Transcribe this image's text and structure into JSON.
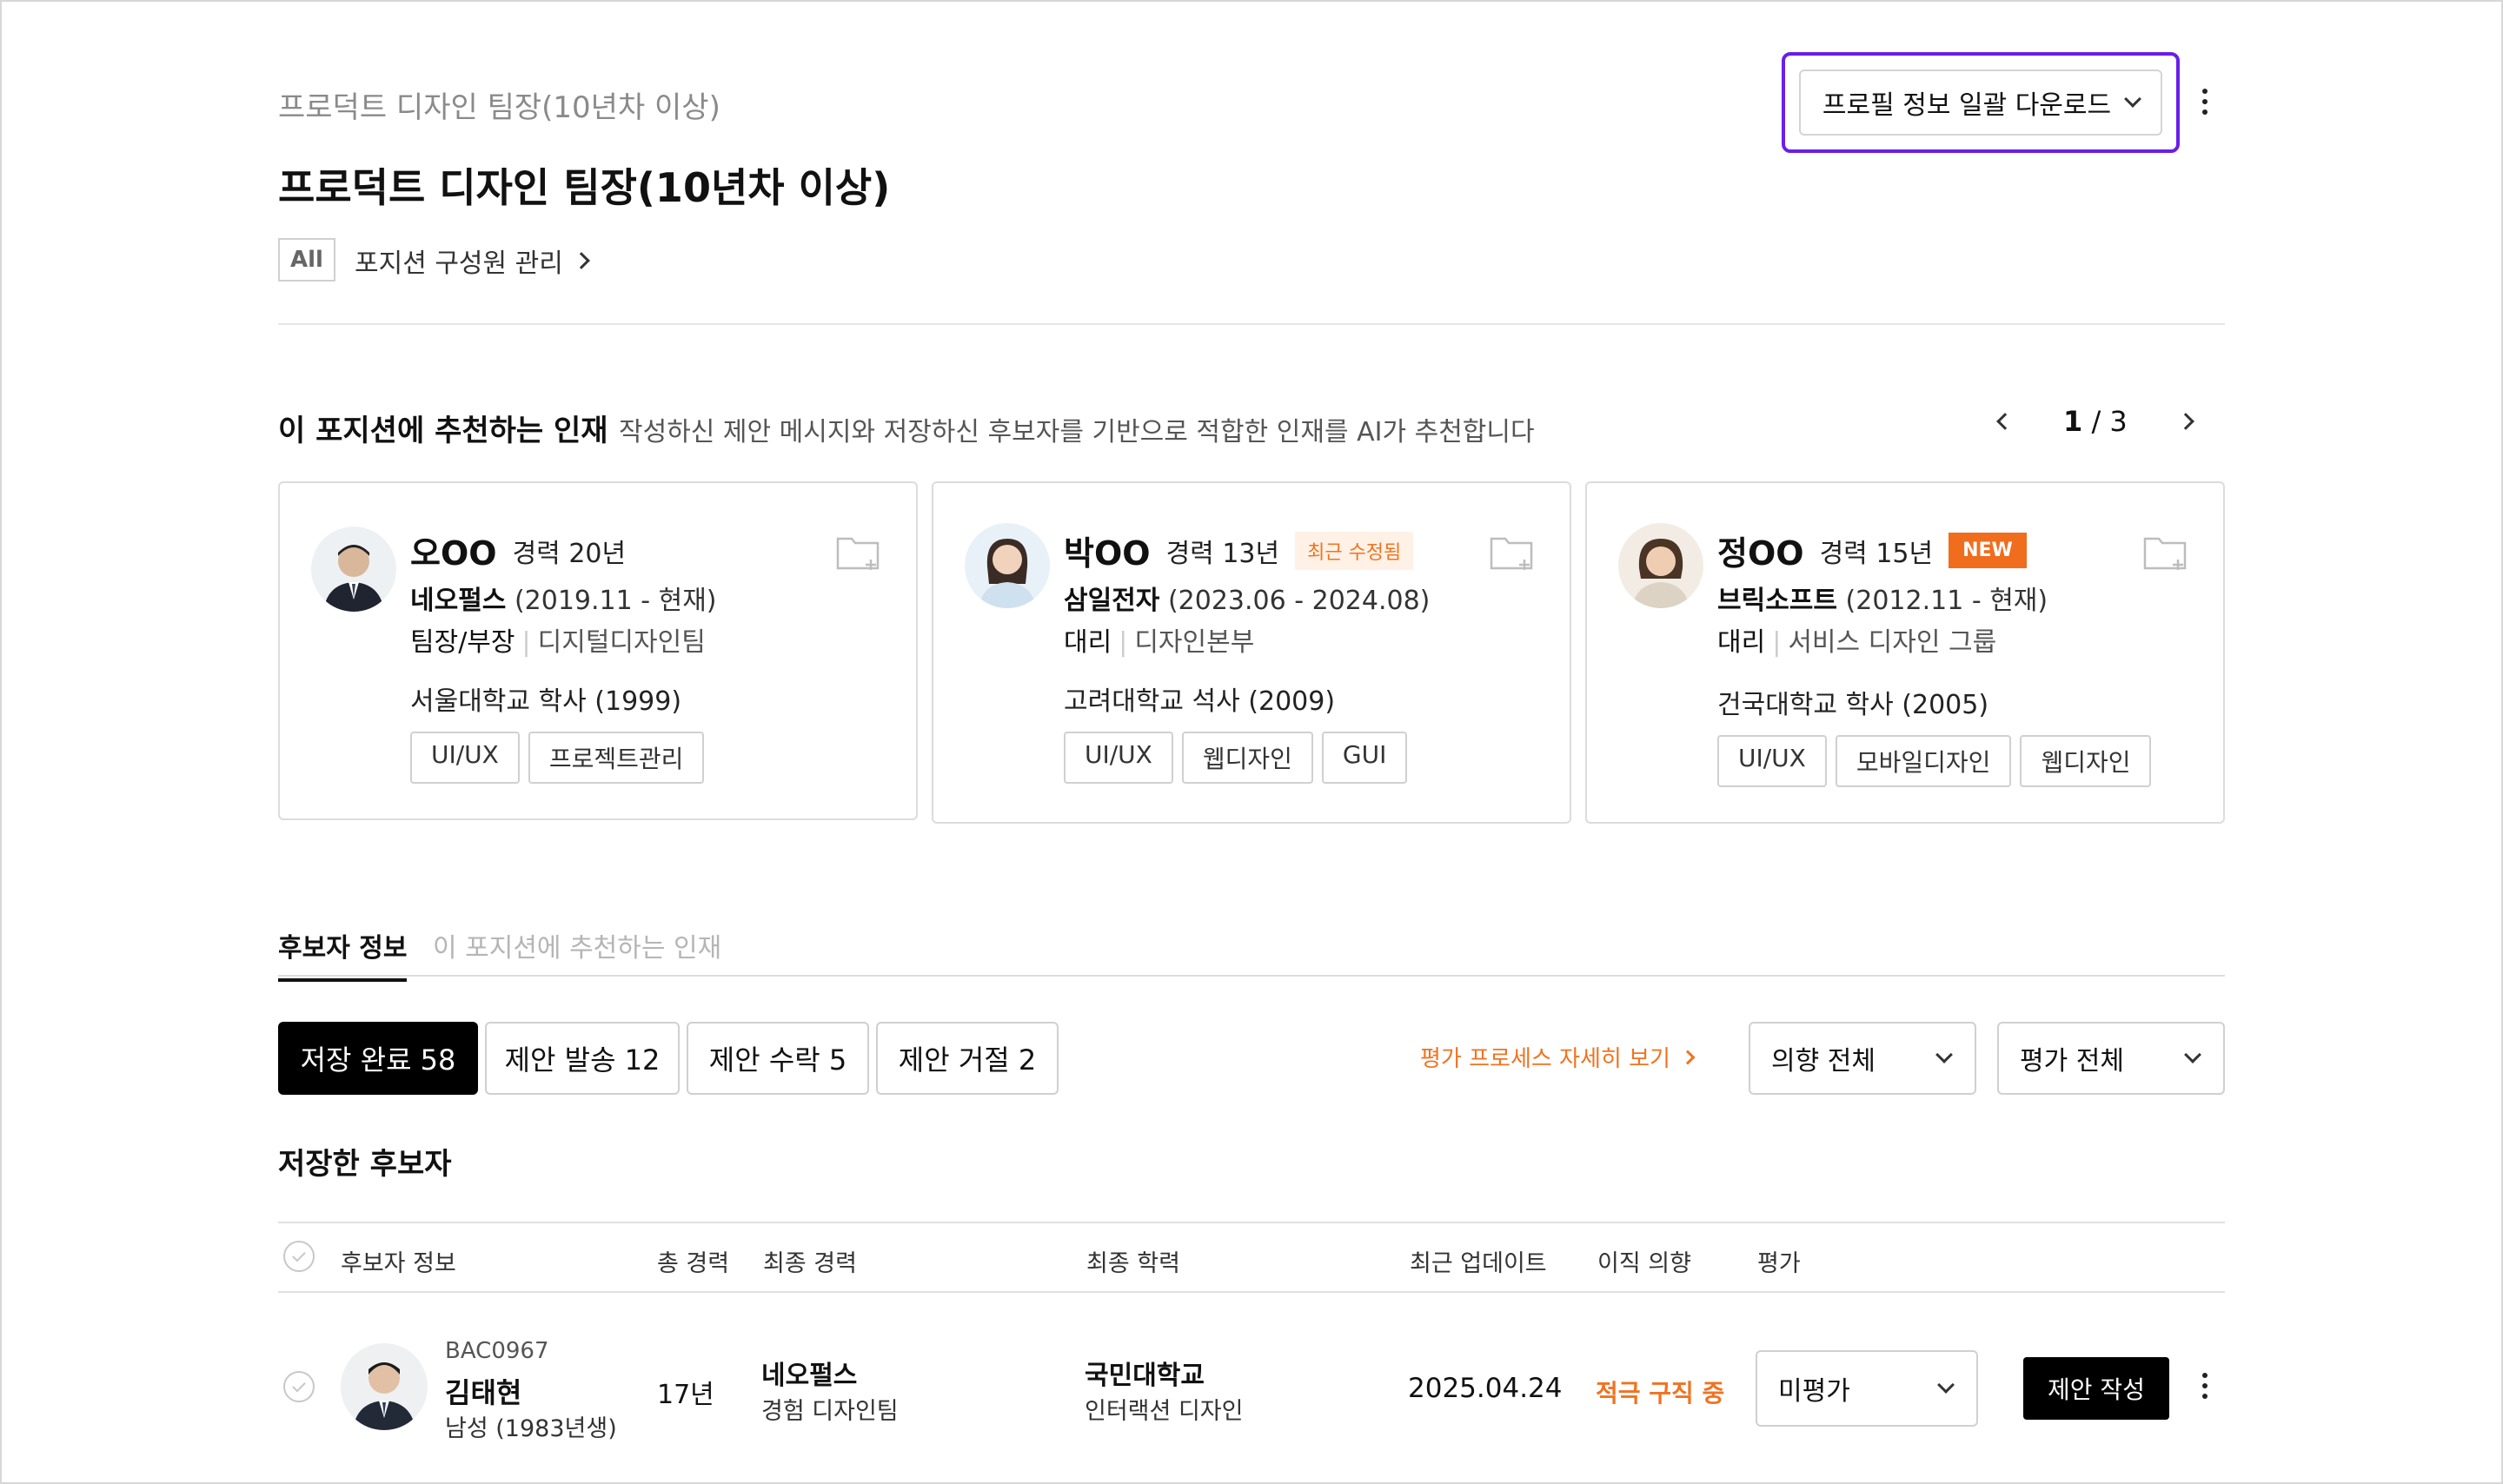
{
  "header": {
    "breadcrumb": "프로덕트 디자인 팀장(10년차 이상)",
    "title": "프로덕트 디자인 팀장(10년차 이상)",
    "all_badge": "All",
    "manage_link": "포지션 구성원 관리",
    "download_label": "프로필 정보 일괄 다운로드"
  },
  "recommend": {
    "title": "이 포지션에 추천하는 인재",
    "description": "작성하신 제안 메시지와 저장하신 후보자를 기반으로 적합한 인재를 AI가 추천합니다",
    "page_current": "1",
    "page_total": "/ 3",
    "cards": [
      {
        "name": "오OO",
        "experience": "경력 20년",
        "badge": "",
        "company": "네오펄스",
        "period": "(2019.11 - 현재)",
        "position": "팀장/부장",
        "department": "디지털디자인팀",
        "education": "서울대학교 학사 (1999)",
        "tags": [
          "UI/UX",
          "프로젝트관리"
        ]
      },
      {
        "name": "박OO",
        "experience": "경력 13년",
        "badge": "최근 수정됨",
        "company": "삼일전자",
        "period": "(2023.06 - 2024.08)",
        "position": "대리",
        "department": "디자인본부",
        "education": "고려대학교 석사 (2009)",
        "tags": [
          "UI/UX",
          "웹디자인",
          "GUI"
        ]
      },
      {
        "name": "정OO",
        "experience": "경력 15년",
        "badge": "NEW",
        "company": "브릭소프트",
        "period": "(2012.11 - 현재)",
        "position": "대리",
        "department": "서비스 디자인 그룹",
        "education": "건국대학교 학사 (2005)",
        "tags": [
          "UI/UX",
          "모바일디자인",
          "웹디자인"
        ]
      }
    ]
  },
  "tabs": {
    "candidate_info": "후보자 정보",
    "recommended": "이 포지션에 추천하는 인재"
  },
  "filters": {
    "segments": [
      "저장 완료 58",
      "제안 발송 12",
      "제안 수락 5",
      "제안 거절 2"
    ],
    "eval_process_link": "평가 프로세스 자세히 보기",
    "intent_select": "의향 전체",
    "eval_select": "평가 전체"
  },
  "saved": {
    "title": "저장한 후보자",
    "columns": [
      "후보자 정보",
      "총 경력",
      "최종 경력",
      "최종 학력",
      "최근 업데이트",
      "이직 의향",
      "평가"
    ],
    "rows": [
      {
        "id": "BAC0967",
        "name": "김태현",
        "gender_birth": "남성 (1983년생)",
        "total_experience": "17년",
        "last_company": "네오펄스",
        "last_role": "경험 디자인팀",
        "school": "국민대학교",
        "major": "인터랙션 디자인",
        "updated": "2025.04.24",
        "intent": "적극 구직 중",
        "evaluation": "미평가",
        "offer_button": "제안 작성"
      }
    ]
  },
  "colors": {
    "accent_orange": "#f07320",
    "focus_purple": "#6a1ee8",
    "primary_black": "#000000"
  },
  "icons": [
    "chevron-right-icon",
    "chevron-down-icon",
    "chevron-left-icon",
    "more-vertical-icon",
    "folder-add-icon",
    "check-circle-icon"
  ]
}
